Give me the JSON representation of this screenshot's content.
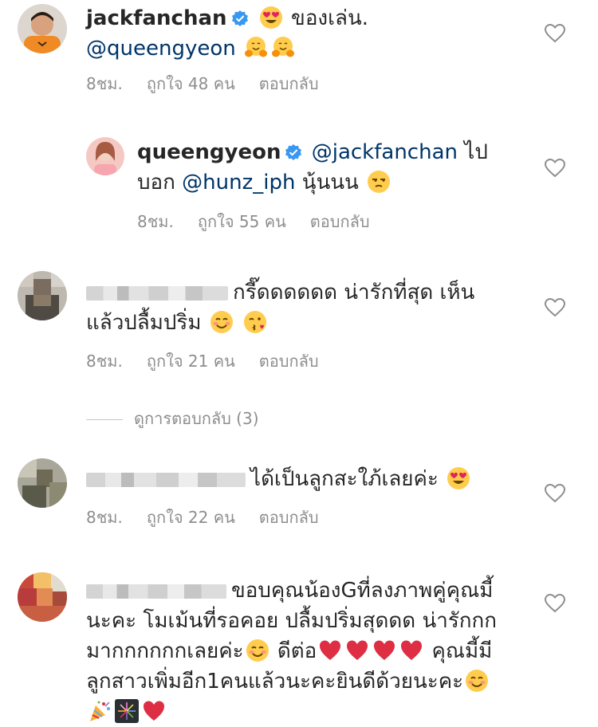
{
  "comments": [
    {
      "username": "jackfanchan",
      "line1_after": "ของเล่น.",
      "line2_mention": "@queengyeon",
      "time": "8ชม.",
      "likes": "ถูกใจ 48 คน",
      "reply": "ตอบกลับ"
    },
    {
      "username": "queengyeon",
      "mention1": "@jackfanchan",
      "word1": "ไป",
      "word2": "บอก",
      "mention2": "@hunz_iph",
      "word3": "นุ้นนน",
      "time": "8ชม.",
      "likes": "ถูกใจ 55 คน",
      "reply": "ตอบกลับ"
    },
    {
      "line1": "กรี๊ดดดดดด น่ารักที่สุด เห็น",
      "line2": "แล้วปลื้มปริ่ม",
      "time": "8ชม.",
      "likes": "ถูกใจ 21 คน",
      "reply": "ตอบกลับ"
    },
    {
      "line1": "ได้เป็นลูกสะใภ้เลยค่ะ",
      "time": "8ชม.",
      "likes": "ถูกใจ 22 คน",
      "reply": "ตอบกลับ"
    },
    {
      "line1": "ขอบคุณน้องGที่ลงภาพคู่คุณมี้",
      "line2": "นะคะ โมเม้นที่รอคอย ปลื้มปริ่มสุดดด น่ารักกก",
      "line3a": "มากกกกกกเลยค่ะ",
      "line3b": "ดีต่อ",
      "line3c": "คุณมี้มี",
      "line4": "ลูกสาวเพิ่มอีก1คนแล้วนะคะยินดีด้วยนะคะ"
    }
  ],
  "view_replies": "ดูการตอบกลับ (3)",
  "icons": {
    "heart": "heart-outline-icon",
    "verified": "verified-badge-icon",
    "heart_eyes": "heart-eyes-emoji",
    "hugging": "hugging-emoji",
    "unamused": "unamused-emoji",
    "blush": "blush-emoji",
    "kiss": "kissing-heart-emoji",
    "red_heart": "red-heart-emoji",
    "party": "party-popper-emoji",
    "fireworks": "fireworks-emoji"
  },
  "colors": {
    "text": "#262626",
    "mention": "#003569",
    "meta": "#8e8e8e",
    "verified": "#3897f0",
    "heart_red": "#ed4956"
  }
}
